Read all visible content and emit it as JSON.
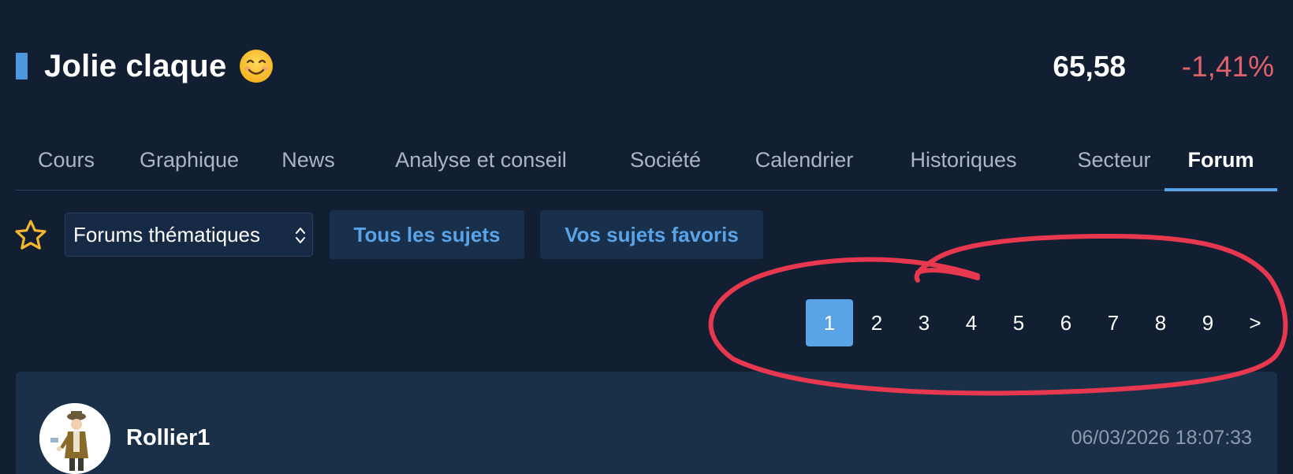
{
  "header": {
    "title": "Jolie claque",
    "emoji_icon": "smiling-face-emoji",
    "price": "65,58",
    "change": "-1,41%"
  },
  "colors": {
    "background": "#121e32",
    "accent": "#5aa3e6",
    "negative": "#e0626a",
    "annotation": "#e8384f"
  },
  "tabs": [
    {
      "label": "Cours"
    },
    {
      "label": "Graphique"
    },
    {
      "label": "News"
    },
    {
      "label": "Analyse et conseil"
    },
    {
      "label": "Société"
    },
    {
      "label": "Calendrier"
    },
    {
      "label": "Historiques"
    },
    {
      "label": "Secteur"
    },
    {
      "label": "Forum",
      "active": true
    }
  ],
  "toolbar": {
    "favorite_icon": "star-outline-icon",
    "forum_select": "Forums thématiques",
    "all_topics": "Tous les sujets",
    "favorite_topics": "Vos sujets favoris"
  },
  "pagination": {
    "pages": [
      "1",
      "2",
      "3",
      "4",
      "5",
      "6",
      "7",
      "8",
      "9"
    ],
    "current": "1",
    "next": ">"
  },
  "post": {
    "author": "Rollier1",
    "date": "06/03/2026 18:07:33"
  }
}
